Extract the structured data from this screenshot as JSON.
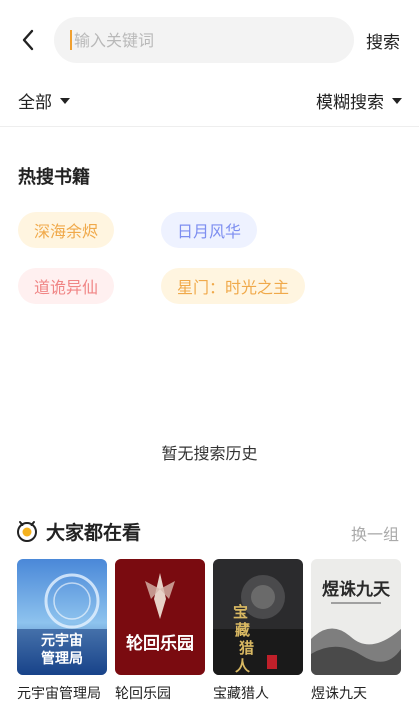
{
  "search": {
    "placeholder": "输入关键词",
    "button_label": "搜索"
  },
  "filters": {
    "scope_label": "全部",
    "mode_label": "模糊搜索"
  },
  "hot_books": {
    "title": "热搜书籍",
    "tags": [
      {
        "label": "深海余烬",
        "bg": "#fff5e0",
        "color": "#f0a94a"
      },
      {
        "label": "日月风华",
        "bg": "#eef2ff",
        "color": "#7d8ef0"
      },
      {
        "label": "道诡异仙",
        "bg": "#fff0f0",
        "color": "#f08585"
      },
      {
        "label": "星门：时光之主",
        "bg": "#fff5e0",
        "color": "#f0a94a"
      }
    ]
  },
  "history": {
    "empty_text": "暂无搜索历史"
  },
  "recommend": {
    "title": "大家都在看",
    "refresh_label": "换一组",
    "books": [
      {
        "title": "元宇宙管理局",
        "cover_text": "元宇宙管理局"
      },
      {
        "title": "轮回乐园",
        "cover_text": "轮回乐园"
      },
      {
        "title": "宝藏猎人",
        "cover_text": "宝藏猎人"
      },
      {
        "title": "煜诛九天",
        "cover_text": "煜诛九天"
      }
    ]
  },
  "colors": {
    "accent": "#f0a030",
    "icon_ring": "#f5b21e"
  }
}
